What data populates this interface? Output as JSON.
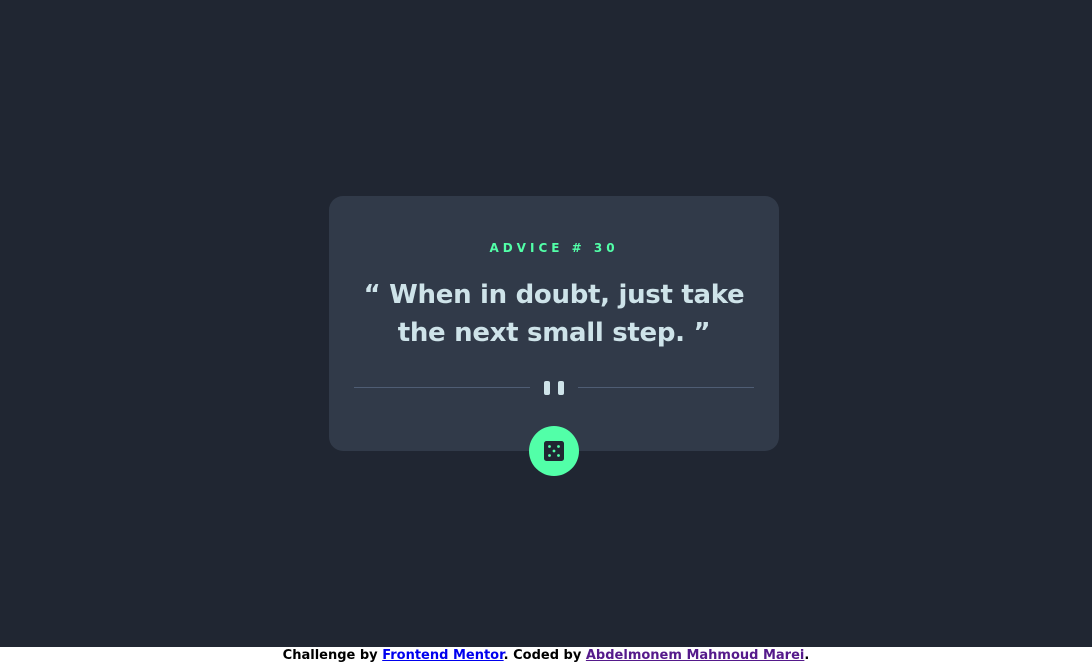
{
  "card": {
    "advice_label": "ADVICE # 30",
    "quote": "“ When in doubt, just take the next small step. ”"
  },
  "icons": {
    "divider": "pause-icon",
    "button": "dice-icon"
  },
  "colors": {
    "background": "#202632",
    "card": "#313a49",
    "accent": "#52ffa8",
    "quote_text": "#cee3e9",
    "divider_line": "#4f5d74"
  },
  "footer": {
    "challenge_prefix": "Challenge by ",
    "challenge_link": "Frontend Mentor",
    "coded_prefix": ". Coded by ",
    "author_link": "Abdelmonem Mahmoud Marei",
    "suffix": "."
  }
}
